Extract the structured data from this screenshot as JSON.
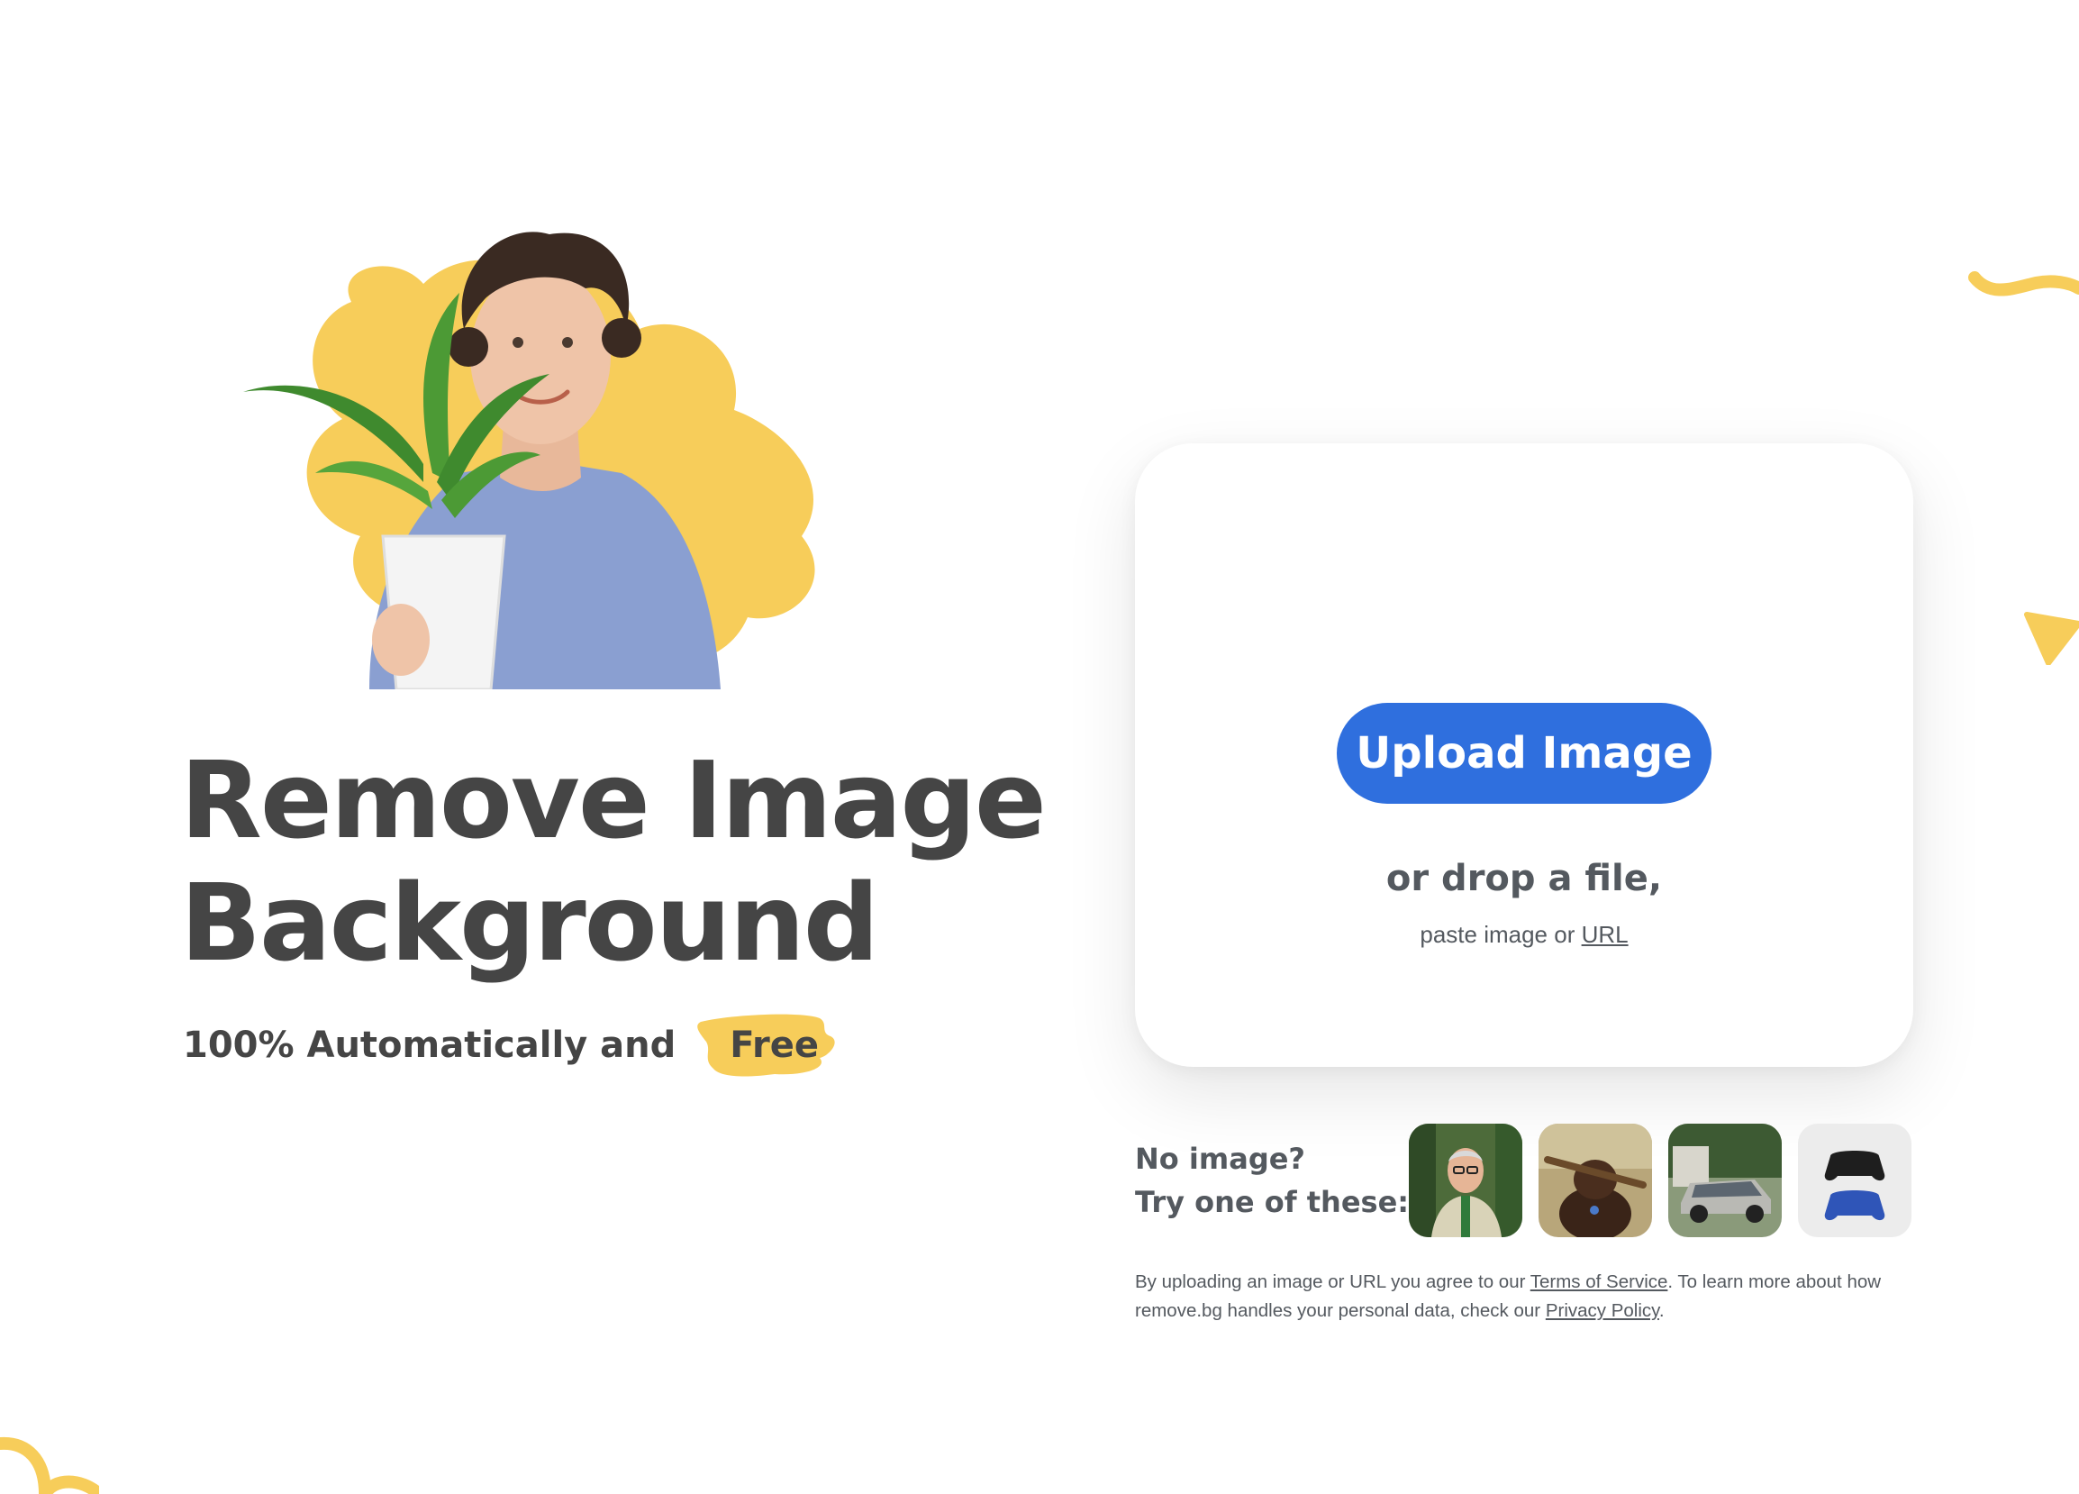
{
  "hero": {
    "title_line1": "Remove Image",
    "title_line2": "Background",
    "subtitle": "100% Automatically and",
    "subtitle_highlight": "Free"
  },
  "upload": {
    "button_label": "Upload Image",
    "drop_text": "or drop a file,",
    "paste_prefix": "paste image or ",
    "url_link": "URL"
  },
  "samples": {
    "line1": "No image?",
    "line2": "Try one of these:",
    "thumbnails": [
      "man-photo",
      "dog-photo",
      "car-photo",
      "gamepads-photo"
    ]
  },
  "legal": {
    "part1": "By uploading an image or URL you agree to our ",
    "terms_link": "Terms of Service",
    "part2": ". To learn more about how remove.bg handles your personal data, check our ",
    "privacy_link": "Privacy Policy",
    "part3": "."
  },
  "colors": {
    "accent_blue": "#2f6fde",
    "brand_yellow": "#f7cd5a",
    "text_dark": "#454545"
  }
}
